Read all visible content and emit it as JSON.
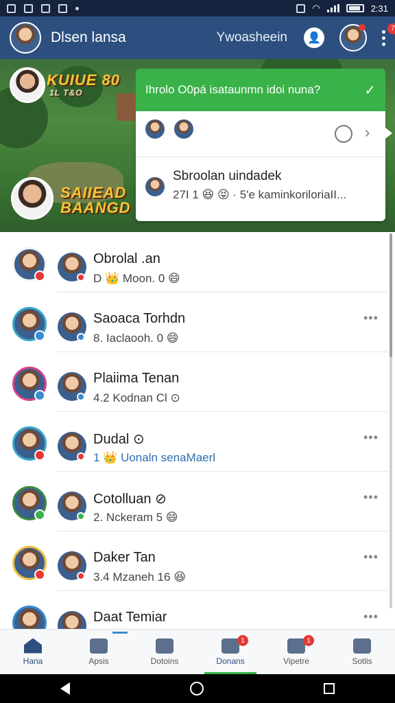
{
  "status_bar": {
    "time": "2:31"
  },
  "header": {
    "title": "Dlsen lansa",
    "subtitle": "Ywoasheein",
    "notification_count": "7"
  },
  "banner": {
    "game_title_top": "KUIUE 80",
    "game_subtitle_top": "1L T&O",
    "game_title_bottom_1": "SAIIEAD",
    "game_title_bottom_2": "BAANGD"
  },
  "popup": {
    "question": "Ihrolo O0pá isataunmn idoi nuna?",
    "check_icon": "check-icon",
    "contact_name": "Sbroolan uindadek",
    "message": "27I 1 😆 😝 · 5'e kaminkoriloriaII..."
  },
  "chats": [
    {
      "name": "Obrolal .an",
      "preview": "D 👑 Moon. 0 😄",
      "status_color": "#e53935",
      "ring": "#f4f4f4",
      "preview_color": "default",
      "more": false
    },
    {
      "name": "Saoaca Torhdn",
      "preview": "8. Iaclaooh. 0 😄",
      "status_color": "#3a8bd0",
      "ring": "#3aa6c8",
      "preview_color": "default",
      "more": true
    },
    {
      "name": "Plaiima Tenan",
      "preview": "4.2 Kodnan Cl ⊙",
      "status_color": "#3a8bd0",
      "ring": "#d9428a",
      "preview_color": "default",
      "more": false
    },
    {
      "name": "Dudal ⊙",
      "preview": "1 👑 Uonaln senaMaerl",
      "status_color": "#e53935",
      "ring": "#3aa6c8",
      "preview_color": "blue",
      "more": true
    },
    {
      "name": "Cotolluan ⊘",
      "preview": "2. Nckeram 5 😄",
      "status_color": "#3ab24a",
      "ring": "#3b8a3a",
      "preview_color": "default",
      "more": true
    },
    {
      "name": "Daker Tan",
      "preview": "3.4 Mzaneh 16 😆",
      "status_color": "#e53935",
      "ring": "#f1c23a",
      "preview_color": "default",
      "more": true
    },
    {
      "name": "Daat Temiar",
      "preview": "",
      "status_color": "#3a8bd0",
      "ring": "#3a8bd0",
      "preview_color": "default",
      "more": true
    }
  ],
  "bottom_nav": [
    {
      "label": "Hana",
      "icon": "home-icon",
      "badge": ""
    },
    {
      "label": "Apsis",
      "icon": "menu-icon",
      "badge": ""
    },
    {
      "label": "Dotoins",
      "icon": "chat-icon",
      "badge": ""
    },
    {
      "label": "Donans",
      "icon": "contacts-icon",
      "badge": "1"
    },
    {
      "label": "Vipetre",
      "icon": "edit-icon",
      "badge": "1"
    },
    {
      "label": "Sotlis",
      "icon": "profile-icon",
      "badge": ""
    }
  ],
  "colors": {
    "header": "#2c4f7f",
    "accent_green": "#3ab24a",
    "badge_red": "#e53935"
  }
}
